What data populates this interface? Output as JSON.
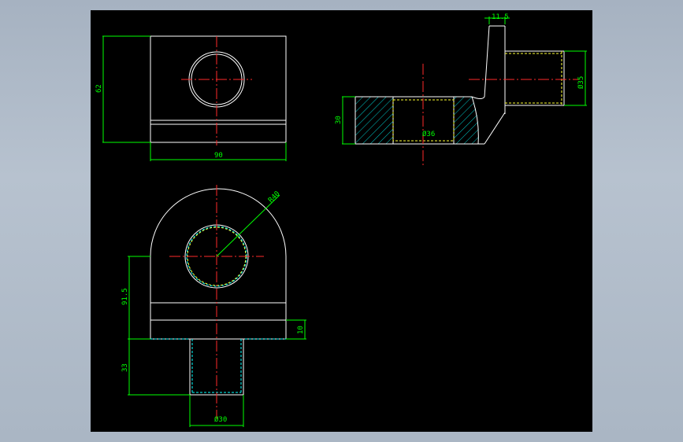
{
  "colors": {
    "background": "#a6b2c1",
    "canvas": "#000000",
    "outline": "#ffffff",
    "dimension": "#00ff00",
    "centerline": "#ff2a2a",
    "hidden_yellow": "#ffff33",
    "hidden_cyan": "#00ffff"
  },
  "top_view": {
    "dim_height": "62",
    "dim_width": "90"
  },
  "side_view": {
    "dim_top": "11.5",
    "dim_right": "Ø35",
    "dim_left": "30",
    "dim_inner": "Ø36"
  },
  "front_view": {
    "dim_radius": "R40",
    "dim_left": "91.5",
    "dim_thickness": "10",
    "dim_stem": "33",
    "dim_bottom": "Ø30"
  }
}
